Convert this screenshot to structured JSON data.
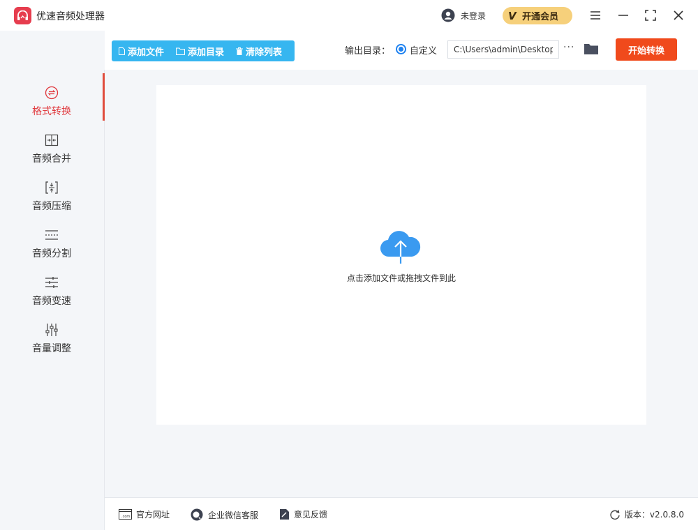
{
  "app": {
    "title": "优速音频处理器",
    "accent": "#e63d4e"
  },
  "header": {
    "user_label": "未登录",
    "vip_mark": "V",
    "vip_label": "开通会员"
  },
  "toolbar": {
    "add_file": "添加文件",
    "add_folder": "添加目录",
    "clear_list": "清除列表",
    "output_label": "输出目录：",
    "radio_label": "自定义",
    "output_path": "C:\\Users\\admin\\Desktop",
    "more": "···",
    "start": "开始转换"
  },
  "sidebar": {
    "items": [
      {
        "label": "格式转换",
        "icon": "format-convert-icon",
        "active": true
      },
      {
        "label": "音频合并",
        "icon": "merge-icon"
      },
      {
        "label": "音频压缩",
        "icon": "compress-icon"
      },
      {
        "label": "音频分割",
        "icon": "split-icon"
      },
      {
        "label": "音频变速",
        "icon": "speed-icon"
      },
      {
        "label": "音量调整",
        "icon": "volume-icon"
      }
    ]
  },
  "dropzone": {
    "hint": "点击添加文件或拖拽文件到此"
  },
  "footer": {
    "website": "官方网址",
    "wechat": "企业微信客服",
    "feedback": "意见反馈",
    "version": "版本：v2.0.8.0"
  },
  "colors": {
    "toolbar_blue": "#36b6f0",
    "start_orange": "#f04a1c",
    "active_red": "#e0393e",
    "cloud_blue": "#3a9af0"
  }
}
